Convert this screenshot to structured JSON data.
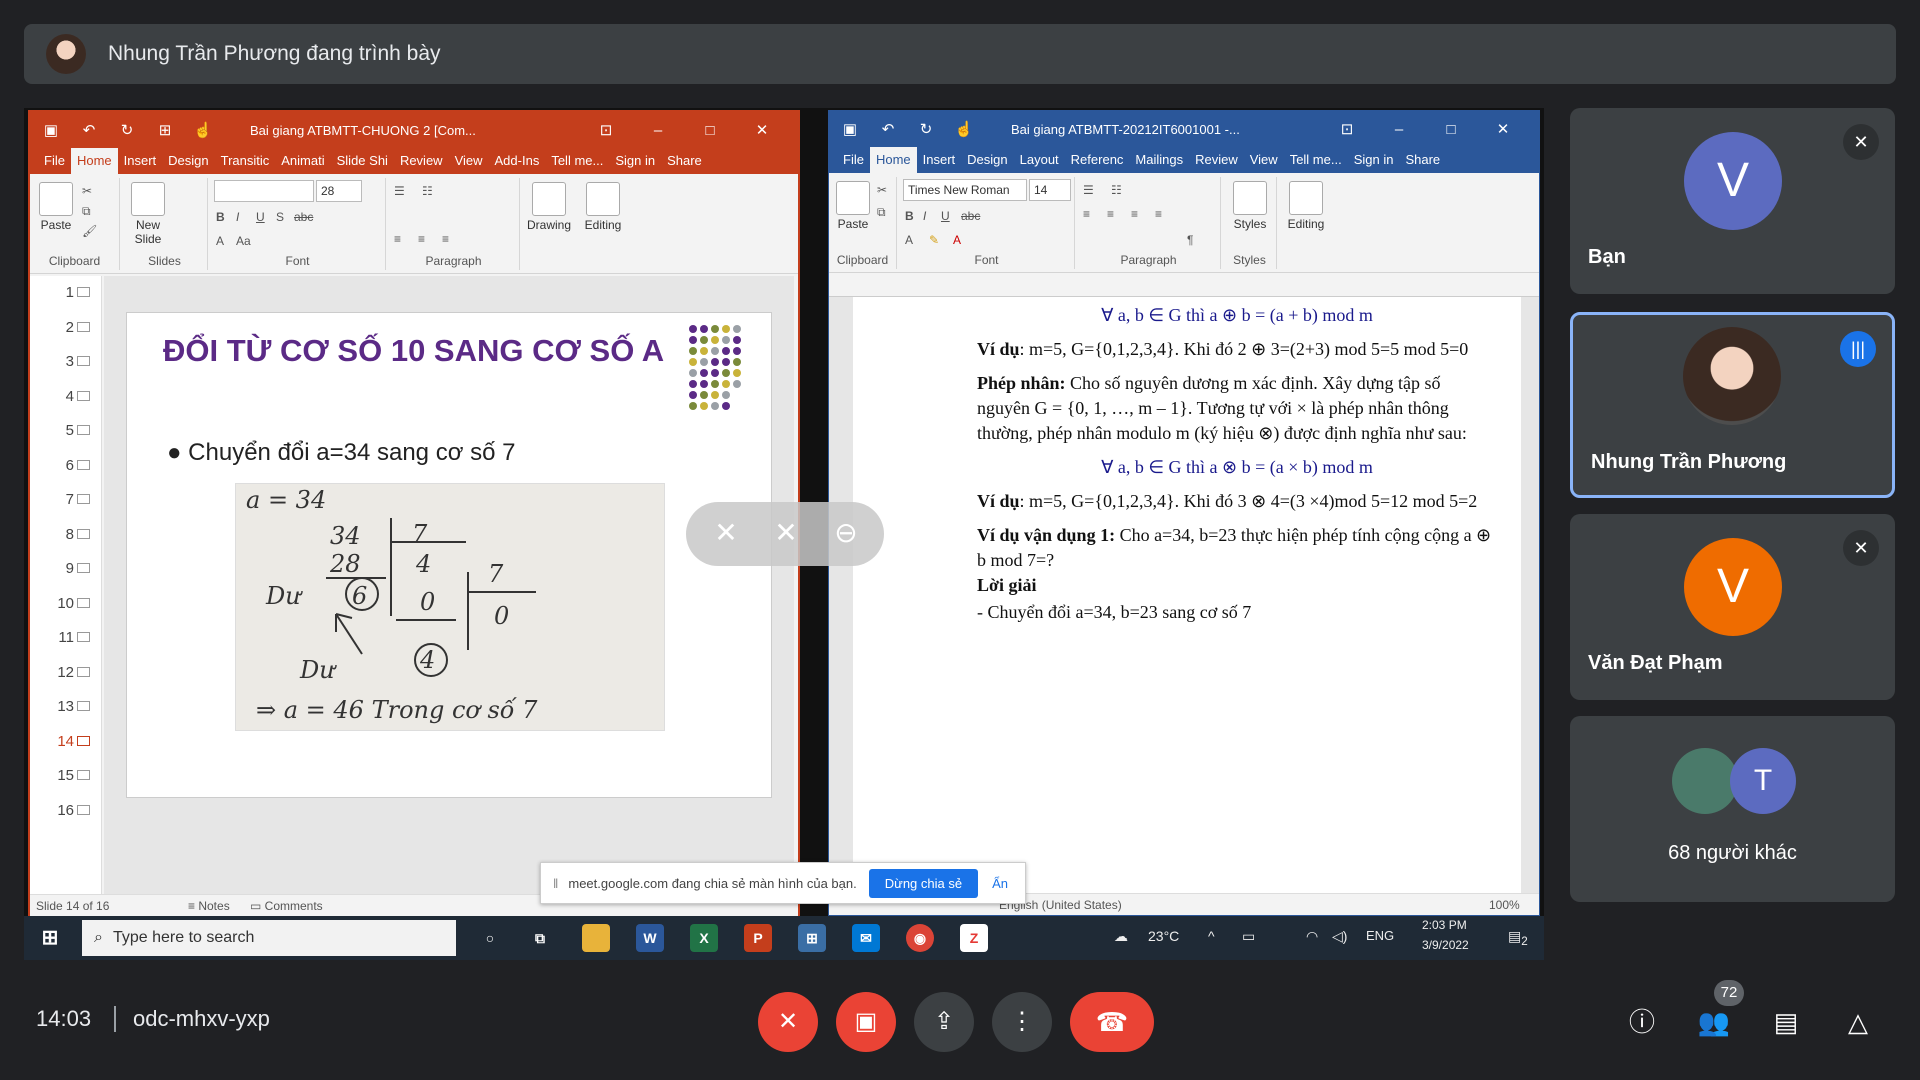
{
  "presenter_bar": {
    "text": "Nhung Trần Phương đang trình bày"
  },
  "powerpoint": {
    "title": "Bai giang ATBMTT-CHUONG 2 [Com...",
    "tabs": [
      "File",
      "Home",
      "Insert",
      "Design",
      "Transitic",
      "Animati",
      "Slide Shi",
      "Review",
      "View",
      "Add-Ins",
      "Tell me...",
      "Sign in",
      "Share"
    ],
    "ribbon": {
      "paste": "Paste",
      "new_slide": "New Slide",
      "drawing": "Drawing",
      "editing": "Editing",
      "font_size": "28",
      "groups": [
        "Clipboard",
        "Slides",
        "Font",
        "Paragraph"
      ]
    },
    "slide_numbers": [
      "1",
      "2",
      "3",
      "4",
      "5",
      "6",
      "7",
      "8",
      "9",
      "10",
      "11",
      "12",
      "13",
      "14",
      "15",
      "16"
    ],
    "active_slide": "14",
    "slide": {
      "title": "ĐỔI TỪ CƠ SỐ 10 SANG CƠ SỐ A",
      "bullet": "Chuyển đổi a=34 sang cơ số 7",
      "handwriting": {
        "l1": "a = 34",
        "l2": "34",
        "l3": "7",
        "l4": "28",
        "l5": "4",
        "l6": "7",
        "l7": "Dư",
        "l8": "6",
        "l9": "0",
        "l10": "0",
        "l11": "4",
        "l12": "Dư",
        "l13": "⇒ a = 46  Trong cơ số 7"
      }
    },
    "status": {
      "slide": "Slide 14 of 16",
      "notes": "Notes",
      "comments": "Comments"
    }
  },
  "word": {
    "title": "Bai giang ATBMTT-20212IT6001001 -...",
    "tabs": [
      "File",
      "Home",
      "Insert",
      "Design",
      "Layout",
      "Referenc",
      "Mailings",
      "Review",
      "View",
      "Tell me...",
      "Sign in",
      "Share"
    ],
    "ribbon": {
      "paste": "Paste",
      "font": "Times New Roman",
      "font_size": "14",
      "styles": "Styles",
      "editing": "Editing",
      "groups": [
        "Clipboard",
        "Font",
        "Paragraph",
        "Styles"
      ]
    },
    "doc": {
      "p1": "∀ a, b ∈ G thì a ⊕ b = (a + b) mod m",
      "p2_label": "Ví dụ",
      "p2": ": m=5, G={0,1,2,3,4}. Khi đó 2 ⊕ 3=(2+3) mod 5=5 mod 5=0",
      "p3_label": "Phép nhân:",
      "p3": " Cho số nguyên dương m xác định. Xây dựng tập số nguyên G = {0, 1, …, m – 1}. Tương tự với × là phép nhân thông thường, phép nhân modulo m (ký hiệu ⊗) được định nghĩa như sau:",
      "p4": "∀ a, b ∈ G thì a ⊗ b = (a × b) mod m",
      "p5_label": "Ví dụ",
      "p5": ": m=5, G={0,1,2,3,4}. Khi đó 3 ⊗ 4=(3 ×4)mod 5=12 mod 5=2",
      "p6_label": "Ví dụ vận dụng 1:",
      "p6": " Cho a=34, b=23 thực hiện phép tính cộng cộng a ⊕ b mod 7=?",
      "p7": "Lời giải",
      "p8": "-    Chuyển đổi a=34, b=23 sang cơ số 7"
    },
    "status": {
      "language": "English (United States)",
      "zoom": "100%"
    }
  },
  "share_notice": {
    "text": "meet.google.com đang chia sẻ màn hình của bạn.",
    "stop": "Dừng chia sẻ",
    "hide": "Ẩn"
  },
  "taskbar": {
    "search": "Type here to search",
    "weather": "23°C",
    "lang": "ENG",
    "time": "2:03 PM",
    "date": "3/9/2022",
    "notif": "2"
  },
  "participants": [
    {
      "initial": "V",
      "name": "Bạn",
      "color": "#5c6bc0"
    },
    {
      "name": "Nhung Trần Phương"
    },
    {
      "initial": "V",
      "name": "Văn Đạt Phạm",
      "color": "#ef6c00"
    },
    {
      "initial": "T",
      "name": "68 người khác",
      "color": "#5c6bc0"
    }
  ],
  "bottom": {
    "time": "14:03",
    "code": "odc-mhxv-yxp",
    "participant_count": "72"
  },
  "colors": {
    "ppt_accent": "#c43e1c",
    "word_accent": "#2b579a",
    "meet_red": "#ea4335",
    "speaking_border": "#8ab4f8"
  }
}
